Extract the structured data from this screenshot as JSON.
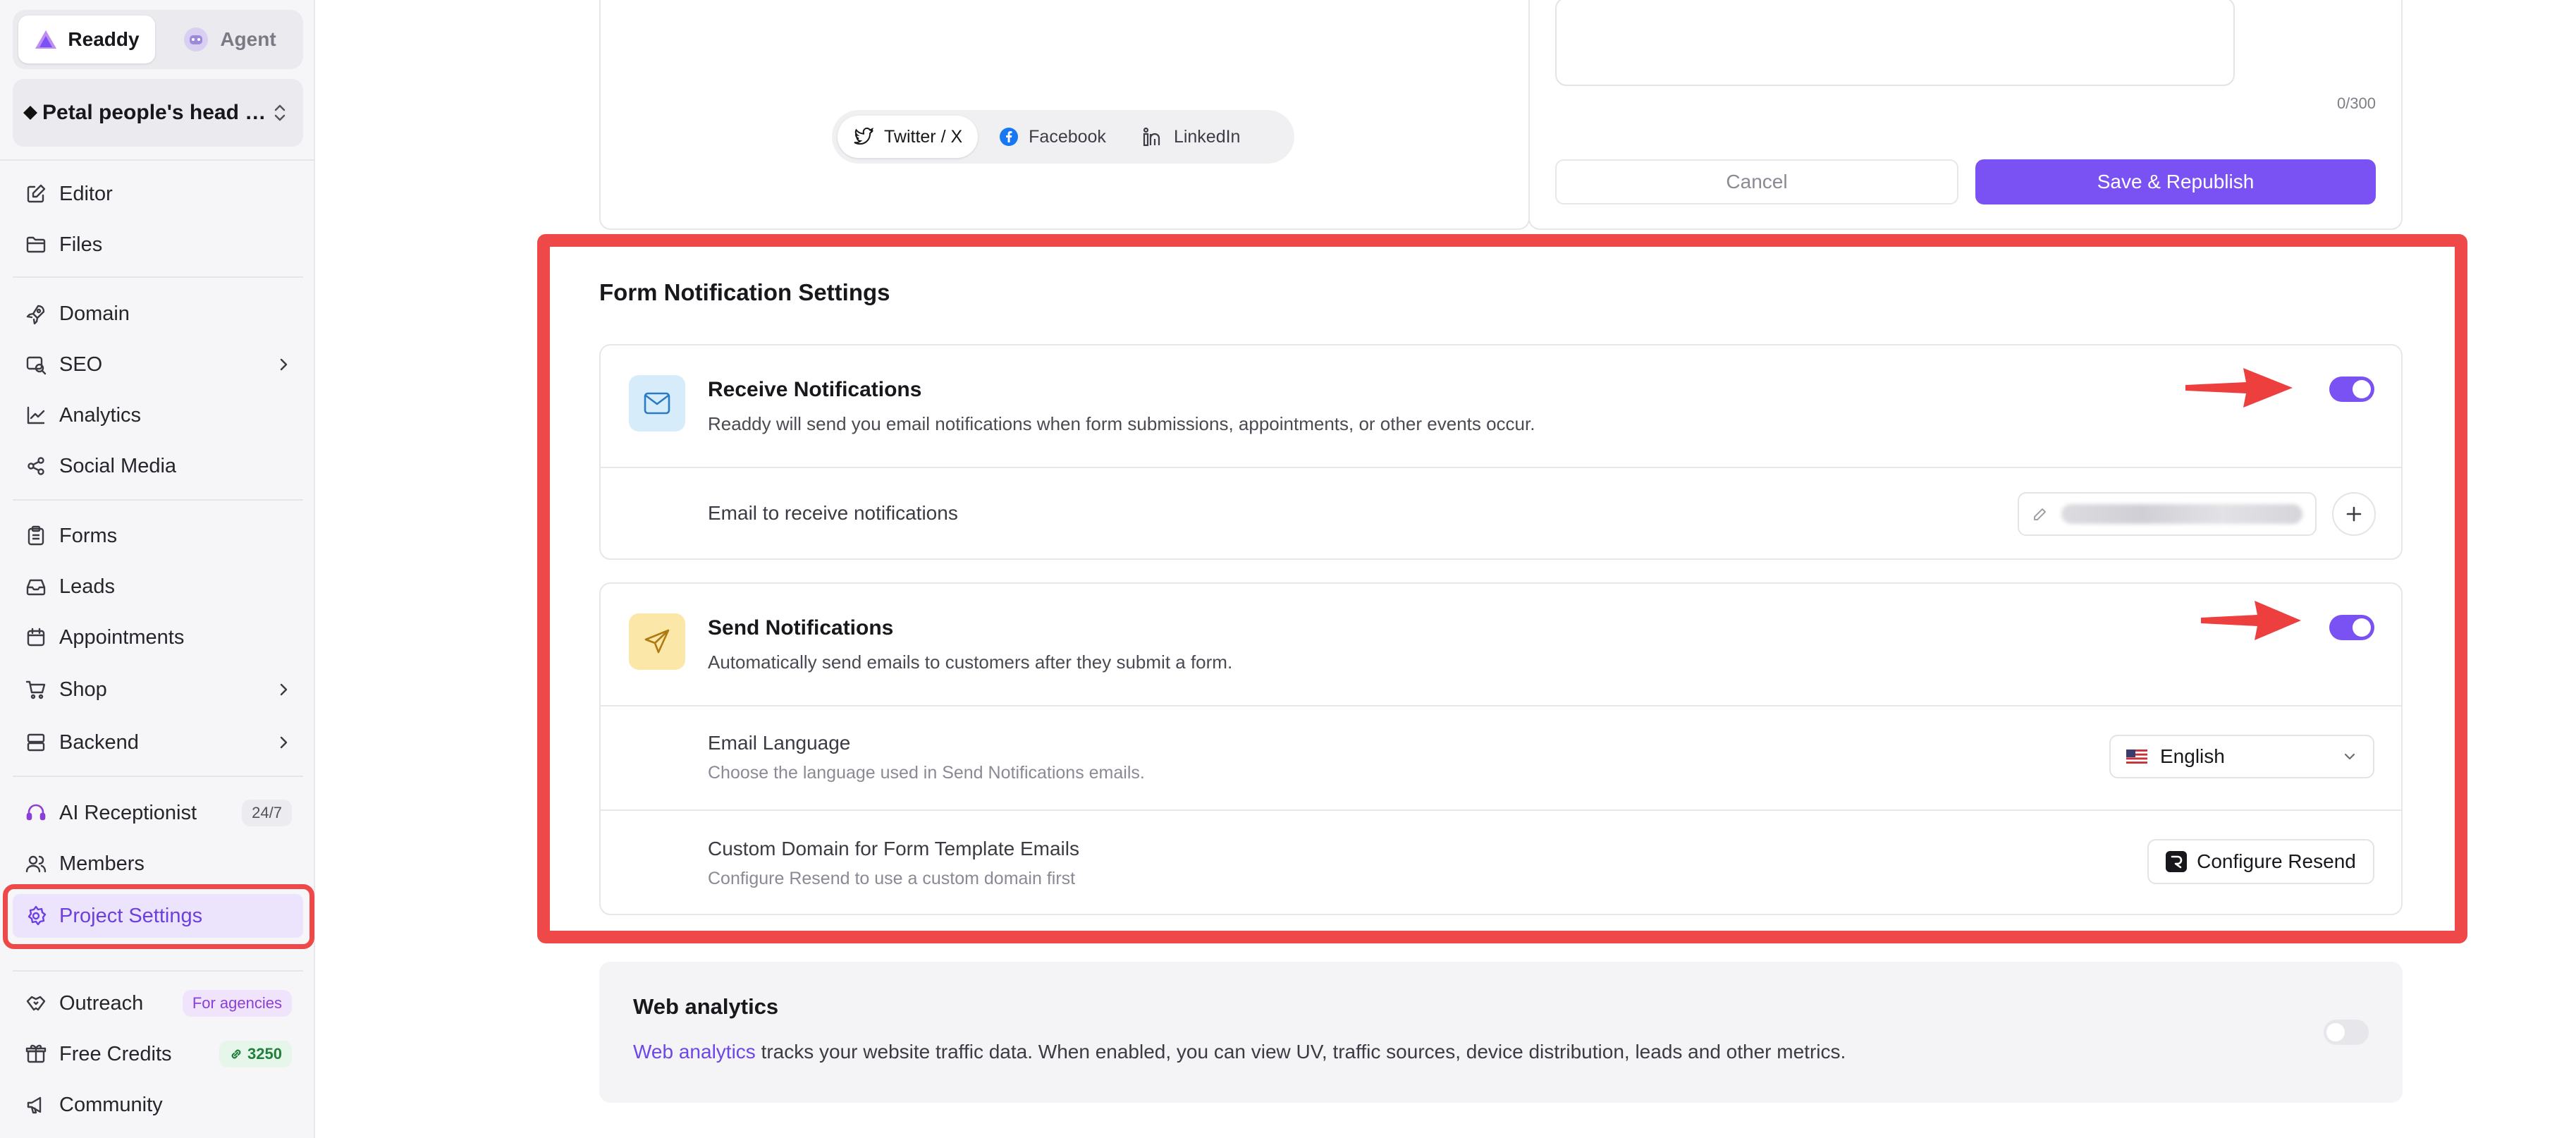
{
  "sidebar": {
    "switch": {
      "readdy": "Readdy",
      "agent": "Agent"
    },
    "project_name": "Petal people's head d...",
    "items": [
      {
        "label": "Editor"
      },
      {
        "label": "Files"
      },
      {
        "label": "Domain"
      },
      {
        "label": "SEO"
      },
      {
        "label": "Analytics"
      },
      {
        "label": "Social Media"
      },
      {
        "label": "Forms"
      },
      {
        "label": "Leads"
      },
      {
        "label": "Appointments"
      },
      {
        "label": "Shop"
      },
      {
        "label": "Backend"
      },
      {
        "label": "AI Receptionist",
        "badge": "24/7"
      },
      {
        "label": "Members"
      },
      {
        "label": "Project Settings"
      },
      {
        "label": "Outreach",
        "badge": "For agencies"
      },
      {
        "label": "Free Credits",
        "badge": "3250"
      },
      {
        "label": "Community"
      }
    ]
  },
  "share": {
    "twitter": "Twitter / X",
    "facebook": "Facebook",
    "linkedin": "LinkedIn"
  },
  "editor": {
    "counter": "0/300",
    "cancel": "Cancel",
    "save": "Save & Republish"
  },
  "notifications": {
    "title": "Form Notification Settings",
    "receive": {
      "title": "Receive Notifications",
      "desc": "Readdy will send you email notifications when form submissions, appointments, or other events occur.",
      "enabled": true,
      "email_label": "Email to receive notifications"
    },
    "send": {
      "title": "Send Notifications",
      "desc": "Automatically send emails to customers after they submit a form.",
      "enabled": true,
      "language_label": "Email Language",
      "language_desc": "Choose the language used in Send Notifications emails.",
      "language_value": "English",
      "domain_label": "Custom Domain for Form Template Emails",
      "domain_desc": "Configure Resend to use a custom domain first",
      "configure_button": "Configure Resend"
    }
  },
  "analytics": {
    "title": "Web analytics",
    "link": "Web analytics",
    "desc": " tracks your website traffic data. When enabled, you can view UV, traffic sources, device distribution, leads and other metrics.",
    "enabled": false
  },
  "colors": {
    "accent": "#7a52f4",
    "highlight": "#ee4848"
  }
}
